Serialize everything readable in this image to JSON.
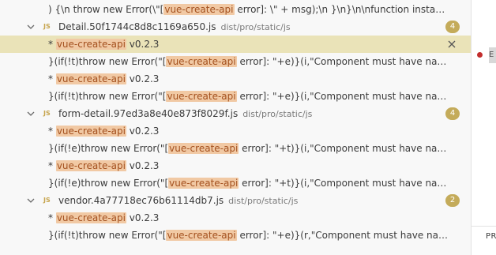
{
  "results": {
    "top_line": "  ) {\\n    throw new Error(\\\"[vue-create-api error]: \\\" + msg);\\n  }\\n}\\n\\nfunction instantiat...",
    "files": [
      {
        "js_badge": "JS",
        "name": "Detail.50f1744c8d8c1169a650.js",
        "path": "dist/pro/static/js",
        "count": "4",
        "matches": [
          {
            "pre": "* ",
            "hl": "vue-create-api",
            "post": " v0.2.3",
            "selected": true
          },
          {
            "pre": "}(if(!t)throw new Error(\"[",
            "hl": "vue-create-api",
            "post": " error]: \"+e)}(i,\"Component must have name w..."
          },
          {
            "pre": "* ",
            "hl": "vue-create-api",
            "post": " v0.2.3"
          },
          {
            "pre": "}(if(!t)throw new Error(\"[",
            "hl": "vue-create-api",
            "post": " error]: \"+e)}(i,\"Component must have name w..."
          }
        ]
      },
      {
        "js_badge": "JS",
        "name": "form-detail.97ed3a8e40e873f8029f.js",
        "path": "dist/pro/static/js",
        "count": "4",
        "matches": [
          {
            "pre": "* ",
            "hl": "vue-create-api",
            "post": " v0.2.3"
          },
          {
            "pre": "}(if(!e)throw new Error(\"[",
            "hl": "vue-create-api",
            "post": " error]: \"+t)}(i,\"Component must have name wh..."
          },
          {
            "pre": "* ",
            "hl": "vue-create-api",
            "post": " v0.2.3"
          },
          {
            "pre": "}(if(!e)throw new Error(\"[",
            "hl": "vue-create-api",
            "post": " error]: \"+t)}(i,\"Component must have name wh..."
          }
        ]
      },
      {
        "js_badge": "JS",
        "name": "vendor.4a77718ec76b61114db7.js",
        "path": "dist/pro/static/js",
        "count": "2",
        "matches": [
          {
            "pre": "* ",
            "hl": "vue-create-api",
            "post": " v0.2.3"
          },
          {
            "pre": "}(if(!t)throw new Error(\"[",
            "hl": "vue-create-api",
            "post": " error]: \"+e)}(r,\"Component must have name wh..."
          }
        ]
      }
    ]
  },
  "editor_pane": {
    "gutter_stub": "E",
    "panel_tab": "PR"
  },
  "colors": {
    "highlight_bg": "#f1c9a4",
    "selected_row_bg": "#eae3b8",
    "badge_bg": "#c4ab5a",
    "error_dot": "#c22d2d"
  },
  "icons": [
    "chevron-down-icon",
    "js-file-icon",
    "close-icon",
    "error-dot-icon"
  ]
}
